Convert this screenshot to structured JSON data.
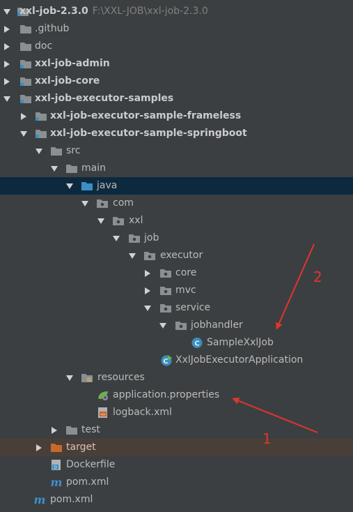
{
  "project": {
    "name": "xxl-job-2.3.0",
    "path": "F:\\XXL-JOB\\xxl-job-2.3.0"
  },
  "tree": [
    {
      "label": ".github"
    },
    {
      "label": "doc"
    },
    {
      "label": "xxl-job-admin"
    },
    {
      "label": "xxl-job-core"
    },
    {
      "label": "xxl-job-executor-samples"
    },
    {
      "label": "xxl-job-executor-sample-frameless"
    },
    {
      "label": "xxl-job-executor-sample-springboot"
    },
    {
      "label": "src"
    },
    {
      "label": "main"
    },
    {
      "label": "java"
    },
    {
      "label": "com"
    },
    {
      "label": "xxl"
    },
    {
      "label": "job"
    },
    {
      "label": "executor"
    },
    {
      "label": "core"
    },
    {
      "label": "mvc"
    },
    {
      "label": "service"
    },
    {
      "label": "jobhandler"
    },
    {
      "label": "SampleXxlJob"
    },
    {
      "label": "XxlJobExecutorApplication"
    },
    {
      "label": "resources"
    },
    {
      "label": "application.properties"
    },
    {
      "label": "logback.xml"
    },
    {
      "label": "test"
    },
    {
      "label": "target"
    },
    {
      "label": "Dockerfile"
    },
    {
      "label": "pom.xml"
    },
    {
      "label": "pom.xml"
    }
  ],
  "annotations": {
    "one": "1",
    "two": "2",
    "color": "#e0362c"
  },
  "colors": {
    "background": "#3c3f41",
    "selected": "#0d293e",
    "excluded": "#4a3f38"
  }
}
